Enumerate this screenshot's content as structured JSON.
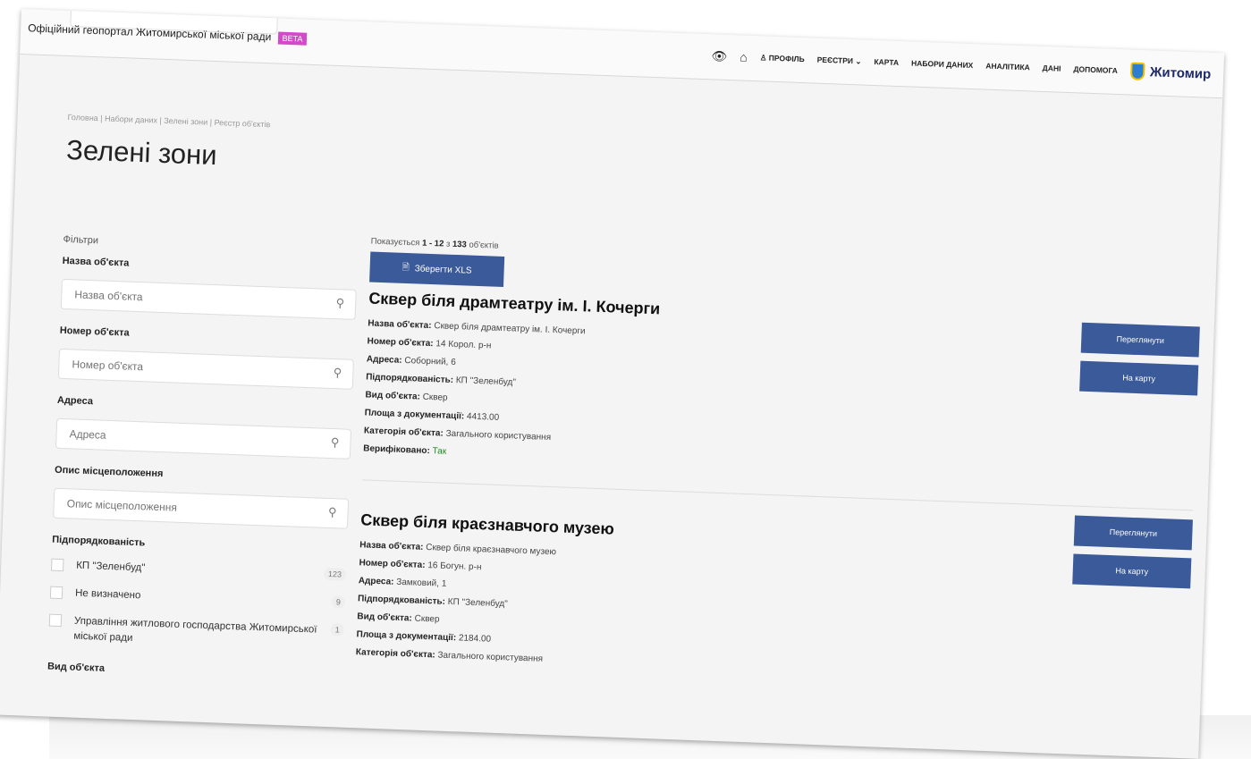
{
  "header": {
    "portal_title": "Офіційний геопортал Житомирської міської ради",
    "beta": "BETA",
    "nav": [
      "ПРОФІЛЬ",
      "РЕЄСТРИ ⌄",
      "КАРТА",
      "НАБОРИ ДАНИХ",
      "АНАЛІТИКА",
      "ДАНІ",
      "ДОПОМОГА"
    ],
    "logo_text": "Житомир"
  },
  "breadcrumb": "Головна  |  Набори даних  |  Зелені зони  |  Реєстр об'єктів",
  "page_title": "Зелені зони",
  "filters": {
    "caption": "Фільтри",
    "name_label": "Назва об'єкта",
    "name_placeholder": "Назва об'єкта",
    "number_label": "Номер об'єкта",
    "number_placeholder": "Номер об'єкта",
    "address_label": "Адреса",
    "address_placeholder": "Адреса",
    "location_label": "Опис місцеположення",
    "location_placeholder": "Опис місцеположення",
    "subordination_label": "Підпорядкованість",
    "subordination_options": [
      {
        "label": "КП \"Зеленбуд\"",
        "count": "123"
      },
      {
        "label": "Не визначено",
        "count": "9"
      },
      {
        "label": "Управління житлового господарства Житомирської міської ради",
        "count": "1"
      }
    ],
    "type_label": "Вид об'єкта"
  },
  "results": {
    "showing_prefix": "Показується",
    "showing_range": "1 - 12",
    "showing_of": "з",
    "showing_total": "133",
    "showing_suffix": "об'єктів",
    "save_xls": "Зберегти XLS",
    "view_label": "Переглянути",
    "map_label": "На карту",
    "items": [
      {
        "title": "Сквер біля драмтеатру ім. І. Кочерги",
        "fields": [
          {
            "k": "Назва об'єкта:",
            "v": "Сквер біля драмтеатру ім. І. Кочерги"
          },
          {
            "k": "Номер об'єкта:",
            "v": "14 Корол. р-н"
          },
          {
            "k": "Адреса:",
            "v": "Соборний, 6"
          },
          {
            "k": "Підпорядкованість:",
            "v": "КП \"Зеленбуд\""
          },
          {
            "k": "Вид об'єкта:",
            "v": "Сквер"
          },
          {
            "k": "Площа з документації:",
            "v": "4413.00"
          },
          {
            "k": "Категорія об'єкта:",
            "v": "Загального користування"
          },
          {
            "k": "Верифіковано:",
            "v": "Так"
          }
        ]
      },
      {
        "title": "Сквер біля краєзнавчого музею",
        "fields": [
          {
            "k": "Назва об'єкта:",
            "v": "Сквер біля краєзнавчого музею"
          },
          {
            "k": "Номер об'єкта:",
            "v": "16 Богун. р-н"
          },
          {
            "k": "Адреса:",
            "v": "Замковий, 1"
          },
          {
            "k": "Підпорядкованість:",
            "v": "КП \"Зеленбуд\""
          },
          {
            "k": "Вид об'єкта:",
            "v": "Сквер"
          },
          {
            "k": "Площа з документації:",
            "v": "2184.00"
          },
          {
            "k": "Категорія об'єкта:",
            "v": "Загального користування"
          }
        ]
      }
    ]
  }
}
